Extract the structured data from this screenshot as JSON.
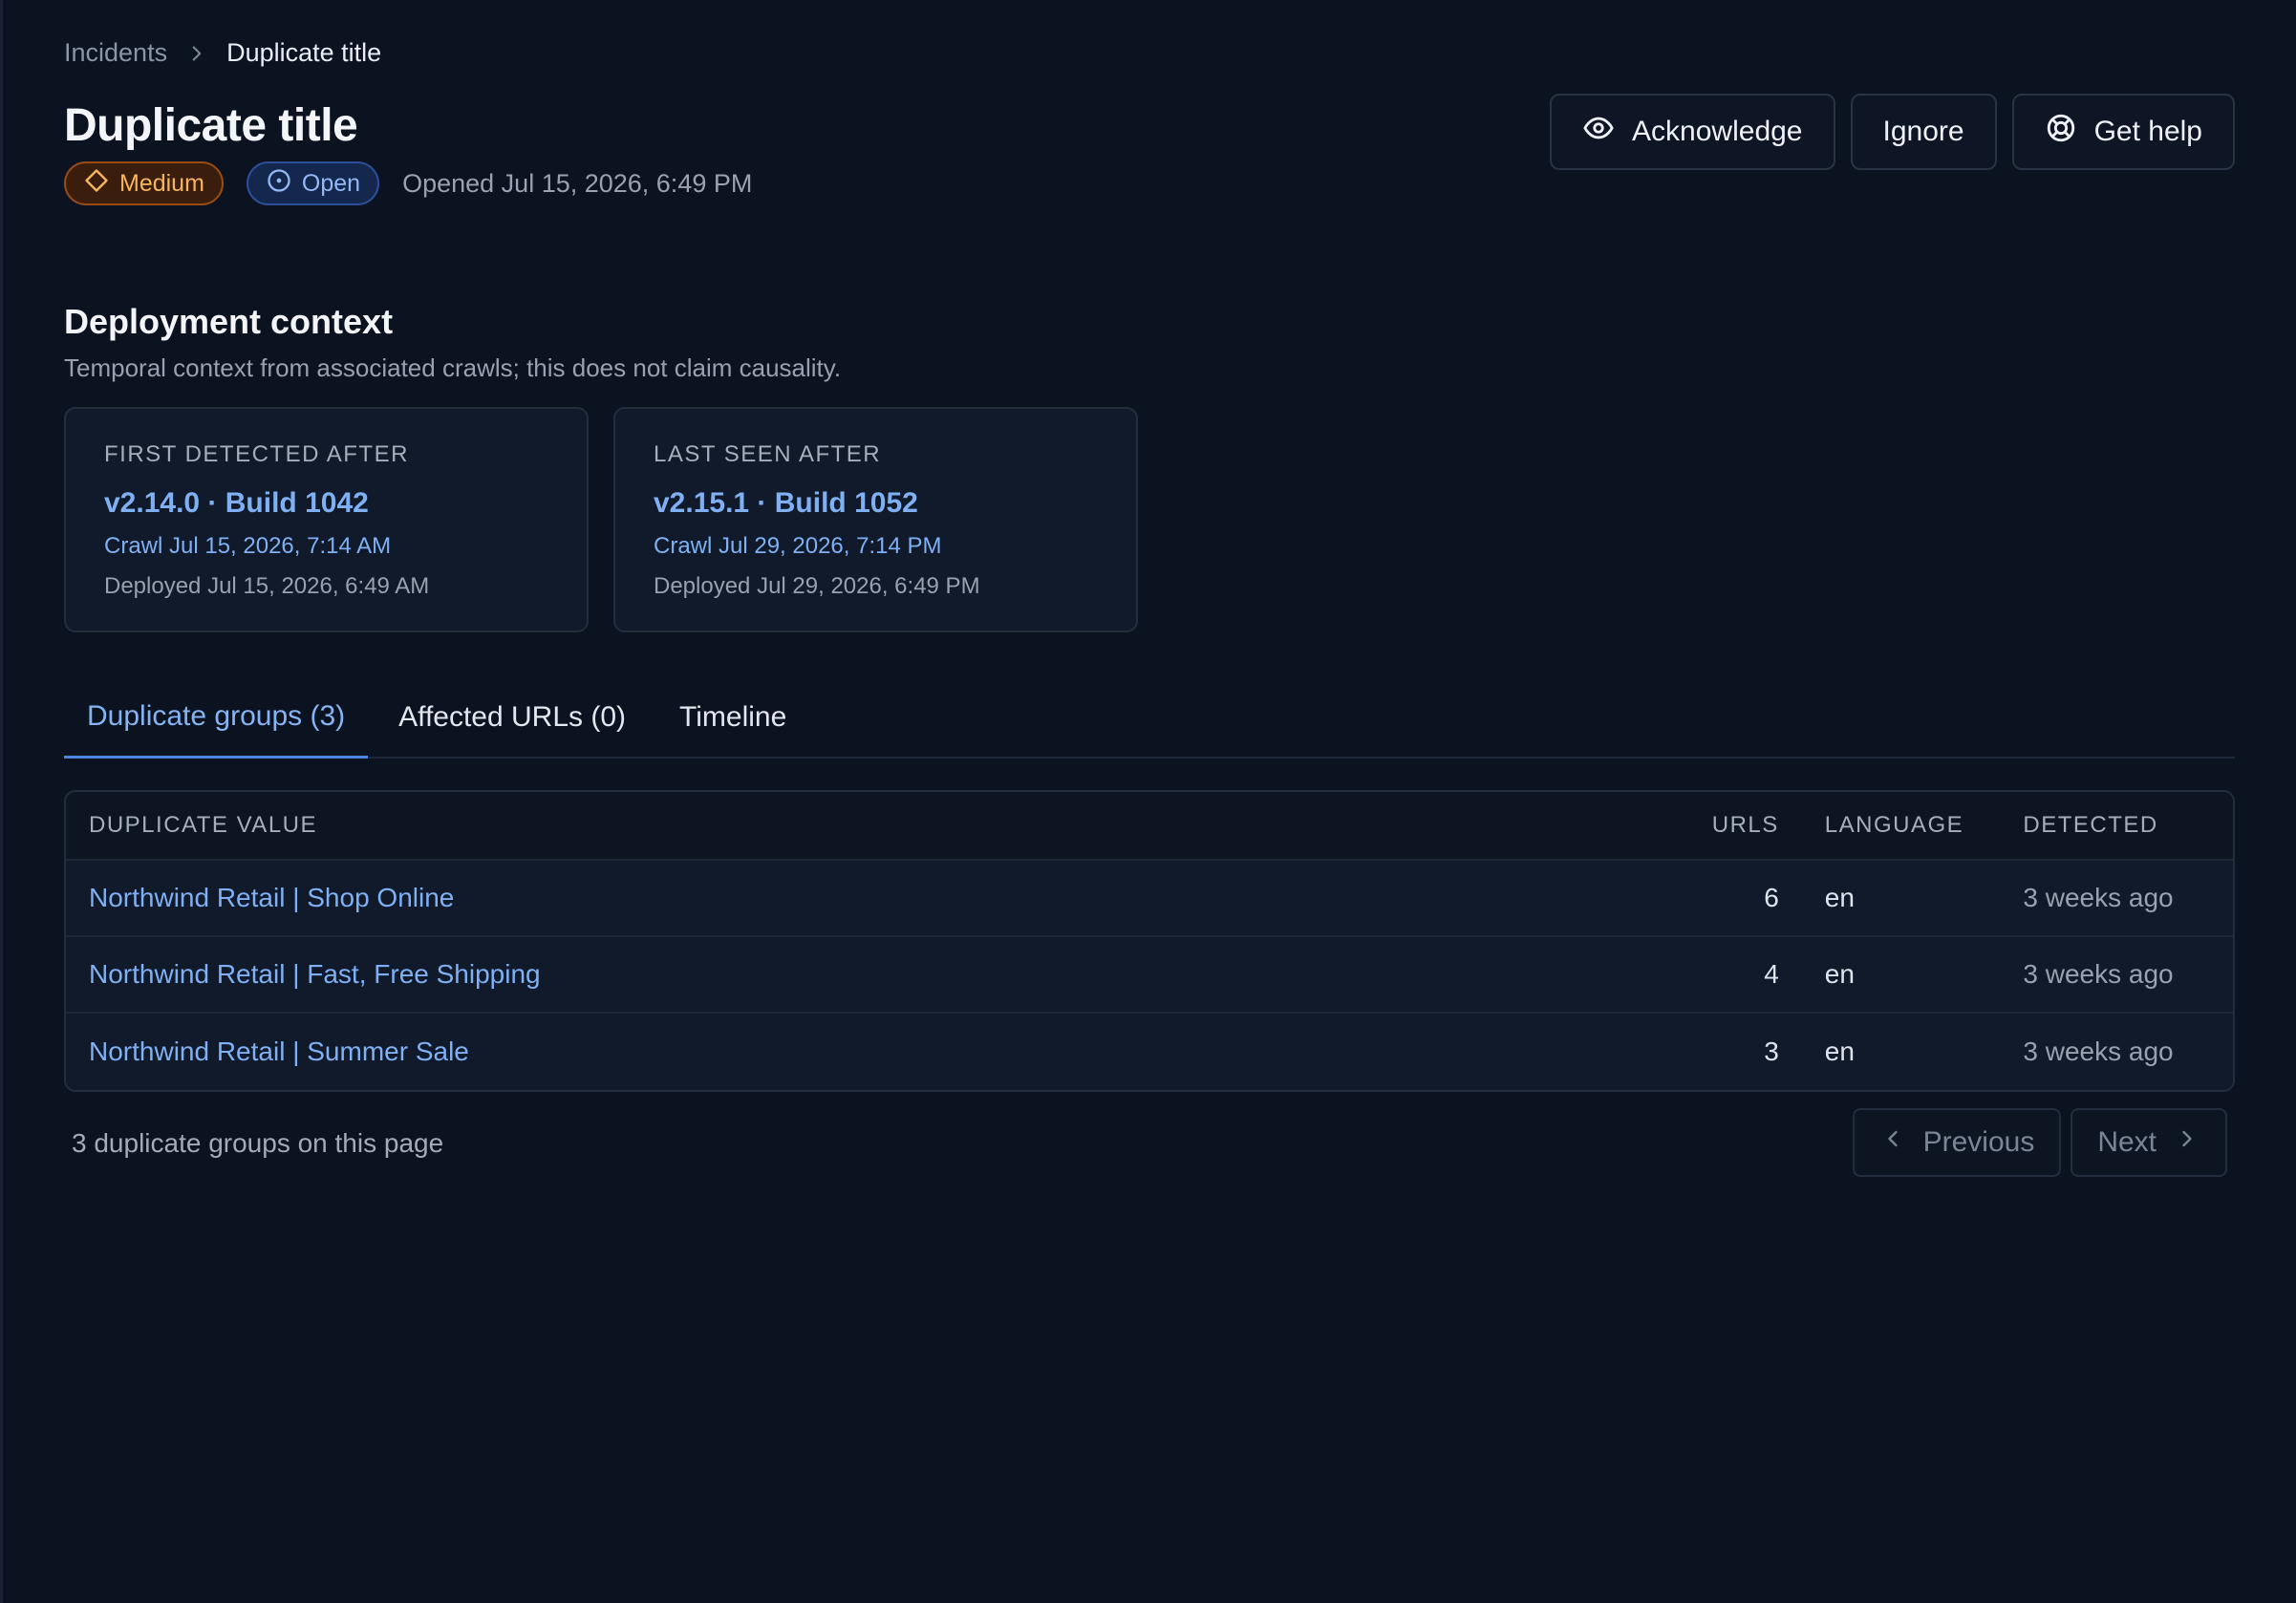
{
  "breadcrumb": {
    "parent": "Incidents",
    "current": "Duplicate title"
  },
  "header": {
    "title": "Duplicate title",
    "severity": "Medium",
    "status": "Open",
    "opened": "Opened Jul 15, 2026, 6:49 PM"
  },
  "actions": {
    "acknowledge": "Acknowledge",
    "ignore": "Ignore",
    "help": "Get help"
  },
  "deployment": {
    "title": "Deployment context",
    "subtitle": "Temporal context from associated crawls; this does not claim causality.",
    "cards": [
      {
        "label": "FIRST DETECTED AFTER",
        "version": "v2.14.0 · Build 1042",
        "crawl": "Crawl Jul 15, 2026, 7:14 AM",
        "deployed": "Deployed Jul 15, 2026, 6:49 AM"
      },
      {
        "label": "LAST SEEN AFTER",
        "version": "v2.15.1 · Build 1052",
        "crawl": "Crawl Jul 29, 2026, 7:14 PM",
        "deployed": "Deployed Jul 29, 2026, 6:49 PM"
      }
    ]
  },
  "tabs": [
    {
      "label": "Duplicate groups (3)",
      "active": true
    },
    {
      "label": "Affected URLs (0)",
      "active": false
    },
    {
      "label": "Timeline",
      "active": false
    }
  ],
  "table": {
    "columns": [
      "DUPLICATE VALUE",
      "URLS",
      "LANGUAGE",
      "DETECTED"
    ],
    "rows": [
      {
        "value": "Northwind Retail | Shop Online",
        "urls": "6",
        "language": "en",
        "detected": "3 weeks ago"
      },
      {
        "value": "Northwind Retail | Fast, Free Shipping",
        "urls": "4",
        "language": "en",
        "detected": "3 weeks ago"
      },
      {
        "value": "Northwind Retail | Summer Sale",
        "urls": "3",
        "language": "en",
        "detected": "3 weeks ago"
      }
    ]
  },
  "footer": {
    "count": "3 duplicate groups on this page",
    "previous": "Previous",
    "next": "Next"
  },
  "colors": {
    "background": "#0b1220",
    "accent": "#7fb0f4",
    "severity_medium": "#f8b65a",
    "status_open": "#93b8f5"
  },
  "icons": {
    "breadcrumb_sep": "chevron-right-icon",
    "severity": "diamond-icon",
    "status": "circle-dot-icon",
    "acknowledge": "eye-icon",
    "help": "lifebuoy-icon",
    "previous": "chevron-left-icon",
    "next": "chevron-right-icon"
  }
}
